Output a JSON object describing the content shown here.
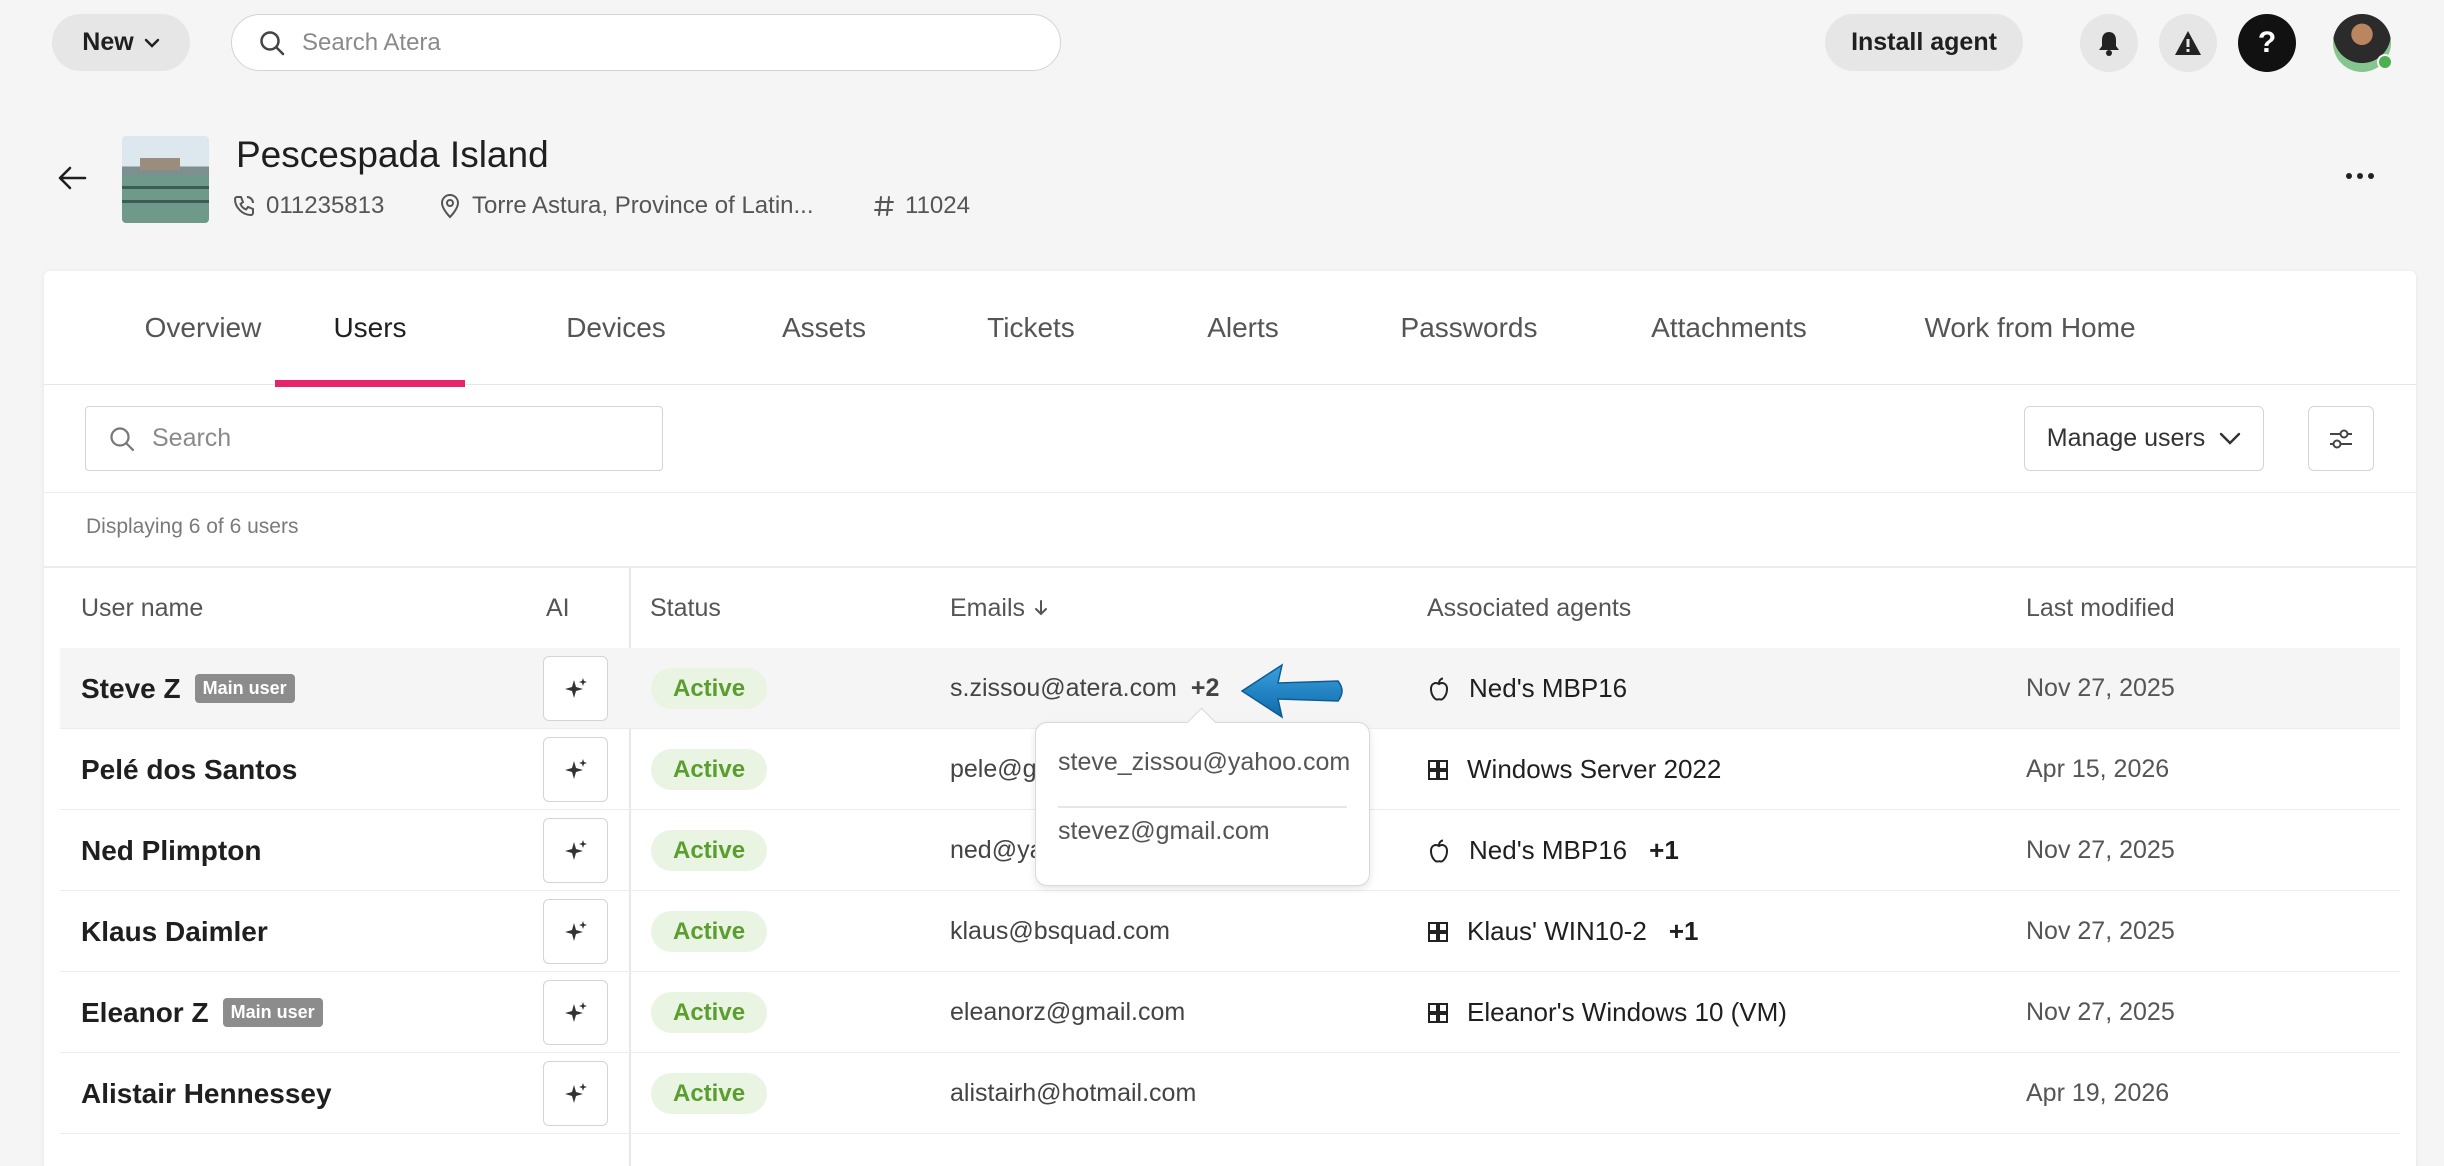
{
  "topbar": {
    "new_label": "New",
    "search_placeholder": "Search Atera",
    "install_label": "Install agent"
  },
  "customer": {
    "name": "Pescespada Island",
    "phone": "011235813",
    "location": "Torre Astura, Province of Latin...",
    "id": "11024"
  },
  "tabs": [
    "Overview",
    "Users",
    "Devices",
    "Assets",
    "Tickets",
    "Alerts",
    "Passwords",
    "Attachments",
    "Work from Home"
  ],
  "active_tab": "Users",
  "filter": {
    "search_placeholder": "Search",
    "manage_label": "Manage users"
  },
  "displaying": "Displaying 6 of 6 users",
  "columns": {
    "user": "User name",
    "ai": "AI",
    "status": "Status",
    "emails": "Emails",
    "agents": "Associated agents",
    "modified": "Last modified"
  },
  "rows": [
    {
      "name": "Steve Z",
      "badge": "Main user",
      "status": "Active",
      "email": "s.zissou@atera.com",
      "email_more": "+2",
      "agent": "Ned's MBP16",
      "agent_os": "apple",
      "agent_more": "",
      "modified": "Nov 27, 2025"
    },
    {
      "name": "Pelé dos Santos",
      "badge": "",
      "status": "Active",
      "email": "pele@gm",
      "email_more": "",
      "agent": "Windows Server 2022",
      "agent_os": "windows",
      "agent_more": "",
      "modified": "Apr 15, 2026"
    },
    {
      "name": "Ned Plimpton",
      "badge": "",
      "status": "Active",
      "email": "ned@ya",
      "email_more": "",
      "agent": "Ned's MBP16",
      "agent_os": "apple",
      "agent_more": "+1",
      "modified": "Nov 27, 2025"
    },
    {
      "name": "Klaus Daimler",
      "badge": "",
      "status": "Active",
      "email": "klaus@bsquad.com",
      "email_more": "",
      "agent": "Klaus' WIN10-2",
      "agent_os": "windows",
      "agent_more": "+1",
      "modified": "Nov 27, 2025"
    },
    {
      "name": "Eleanor Z",
      "badge": "Main user",
      "status": "Active",
      "email": "eleanorz@gmail.com",
      "email_more": "",
      "agent": "Eleanor's Windows 10 (VM)",
      "agent_os": "windows",
      "agent_more": "",
      "modified": "Nov 27, 2025"
    },
    {
      "name": "Alistair Hennessey",
      "badge": "",
      "status": "Active",
      "email": "alistairh@hotmail.com",
      "email_more": "",
      "agent": "",
      "agent_os": "",
      "agent_more": "",
      "modified": "Apr 19, 2026"
    }
  ],
  "email_popup": [
    "steve_zissou@yahoo.com",
    "stevez@gmail.com"
  ],
  "colors": {
    "accent": "#e6236b",
    "status_bg": "#eaf4e3",
    "status_text": "#5a9e2f",
    "annotation_arrow": "#1a7fc1"
  }
}
